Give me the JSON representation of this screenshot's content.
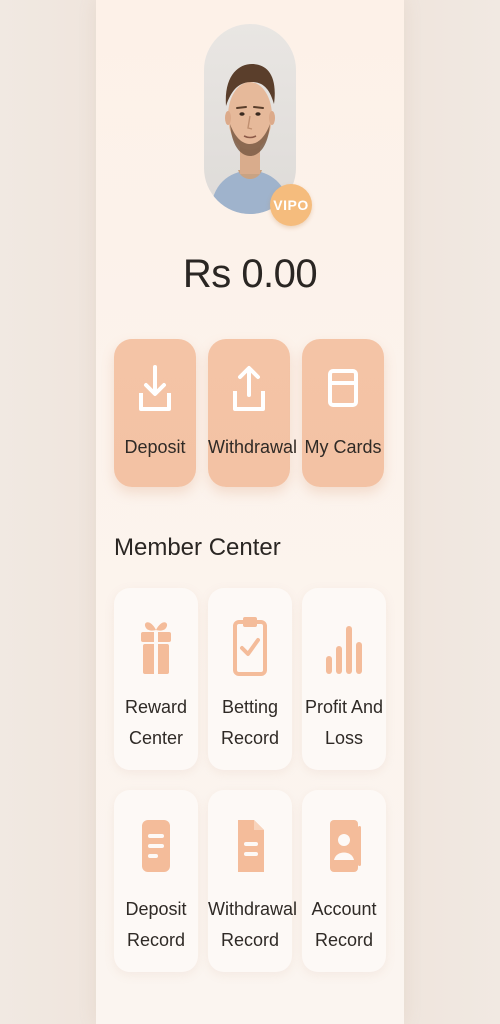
{
  "profile": {
    "vip_label": "VIPO"
  },
  "wallet": {
    "balance": "Rs 0.00"
  },
  "actions": [
    {
      "label": "Deposit",
      "icon": "download-icon"
    },
    {
      "label": "Withdrawal",
      "icon": "upload-icon"
    },
    {
      "label": "My Cards",
      "icon": "card-icon"
    }
  ],
  "member_center": {
    "title": "Member Center",
    "items": [
      {
        "line1": "Reward",
        "line2": "Center",
        "icon": "gift-icon"
      },
      {
        "line1": "Betting",
        "line2": "Record",
        "icon": "clipboard-check-icon"
      },
      {
        "line1": "Profit And",
        "line2": "Loss",
        "icon": "bar-chart-icon"
      },
      {
        "line1": "Deposit",
        "line2": "Record",
        "icon": "document-icon"
      },
      {
        "line1": "Withdrawal",
        "line2": "Record",
        "icon": "file-icon"
      },
      {
        "line1": "Account",
        "line2": "Record",
        "icon": "contact-book-icon"
      }
    ]
  },
  "colors": {
    "accent": "#f3c2a4",
    "icon_color": "#f4bc9a",
    "vip_badge": "#f5bc7d",
    "text_dark": "#2a2623",
    "panel_bg": "#fdf1e8"
  }
}
